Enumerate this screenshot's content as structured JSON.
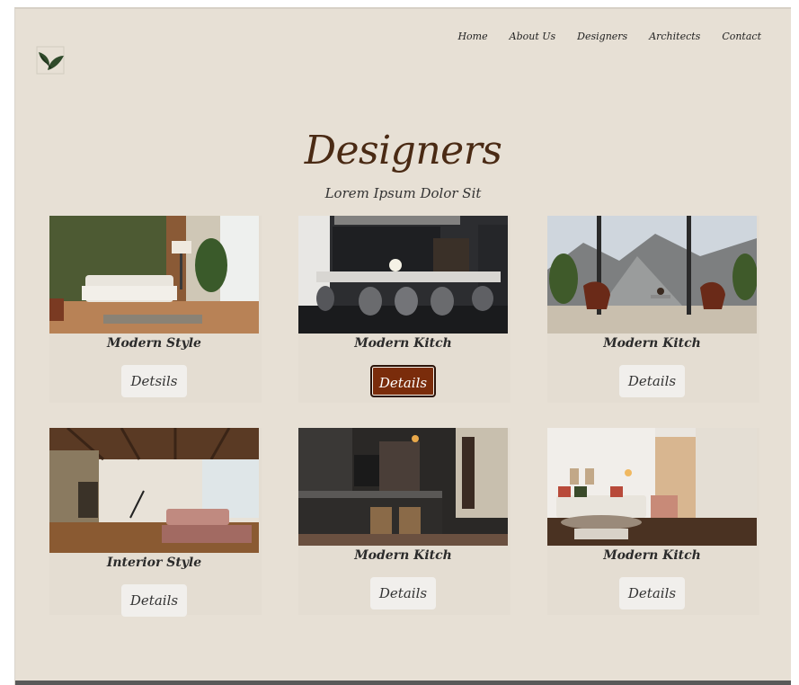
{
  "nav": {
    "items": [
      {
        "label": "Home"
      },
      {
        "label": "About Us"
      },
      {
        "label": "Designers"
      },
      {
        "label": "Architects"
      },
      {
        "label": "Contact"
      }
    ]
  },
  "header": {
    "title": "Designers",
    "subtitle": "Lorem Ipsum Dolor Sit"
  },
  "cards": [
    {
      "name": "Modern Style",
      "button": "Detsils"
    },
    {
      "name": "Modern Kitch",
      "button": "Details"
    },
    {
      "name": "Modern Kitch",
      "button": "Details"
    },
    {
      "name": "Interior Style",
      "button": "Details"
    },
    {
      "name": "Modern Kitch",
      "button": "Details"
    },
    {
      "name": "Modern Kitch",
      "button": "Details"
    }
  ],
  "colors": {
    "page_bg": "#e7e0d5",
    "title": "#4a2a14",
    "accent_button": "#7a2c0b"
  },
  "icons": {
    "logo": "leaf-icon"
  }
}
